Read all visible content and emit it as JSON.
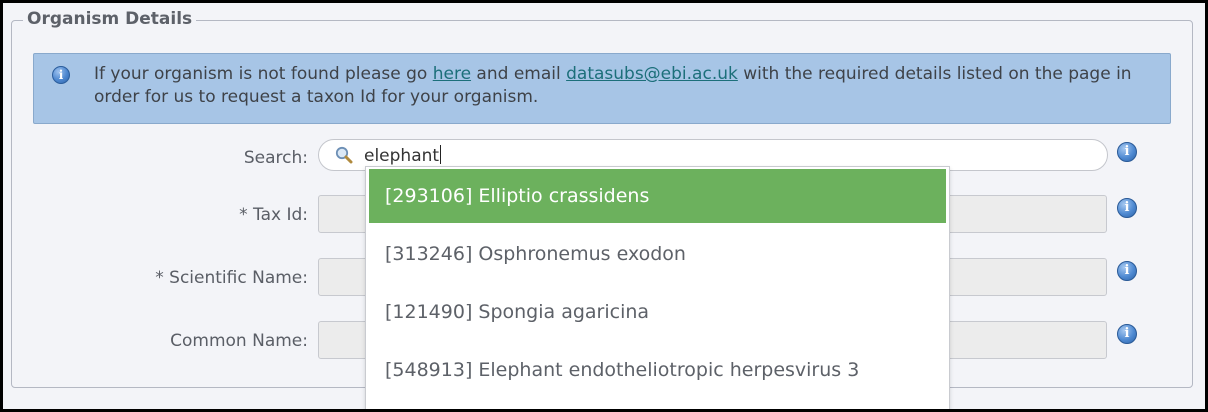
{
  "fieldset": {
    "legend": "Organism Details"
  },
  "info": {
    "icon": "info-icon",
    "text_before": "If your organism is not found please go ",
    "link_here": "here",
    "text_middle": " and email ",
    "email": "datasubs@ebi.ac.uk",
    "text_after": " with the required details listed on the page in order for us to request a taxon Id for your organism."
  },
  "search": {
    "label": "Search:",
    "value": "elephant",
    "icon": "search-icon"
  },
  "fields": {
    "tax_id_label": "* Tax Id:",
    "scientific_name_label": "* Scientific Name:",
    "common_name_label": "Common Name:"
  },
  "dropdown": {
    "items": [
      {
        "label": "[293106] Elliptio crassidens",
        "active": true
      },
      {
        "label": "[313246] Osphronemus exodon",
        "active": false
      },
      {
        "label": "[121490] Spongia agaricina",
        "active": false
      },
      {
        "label": "[548913] Elephant endotheliotropic herpesvirus 3",
        "active": false
      }
    ]
  },
  "colors": {
    "active_item": "#6cb15d",
    "info_box": "#a7c5e6",
    "link": "#1c6f7a"
  }
}
